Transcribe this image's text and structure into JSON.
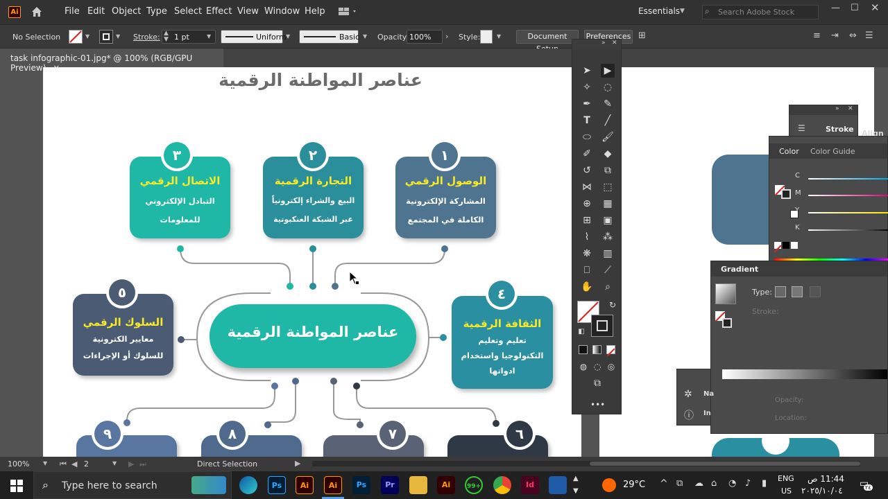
{
  "menubar": {
    "logo": "Ai",
    "items": [
      "File",
      "Edit",
      "Object",
      "Type",
      "Select",
      "Effect",
      "View",
      "Window",
      "Help"
    ],
    "workspace": "Essentials",
    "search_placeholder": "Search Adobe Stock"
  },
  "control": {
    "selection": "No Selection",
    "stroke_label": "Stroke:",
    "stroke_value": "1 pt",
    "profile": "Uniform",
    "brush": "Basic",
    "opacity_label": "Opacity:",
    "opacity_value": "100%",
    "style_label": "Style:",
    "doc_setup": "Document Setup",
    "preferences": "Preferences"
  },
  "tab": {
    "title": "task infographic-01.jpg* @ 100% (RGB/GPU Preview)",
    "close": "×"
  },
  "artboard": {
    "heading": "عناصر المواطنة الرقمية",
    "center_label": "عناصر المواطنة الرقمية",
    "cards": [
      {
        "num": "١",
        "title": "الوصول الرقمي",
        "lines": [
          "المشاركة الإلكترونية",
          "الكاملة في المجتمع"
        ],
        "color": "#4f7490"
      },
      {
        "num": "٢",
        "title": "التجارة الرقمية",
        "lines": [
          "البيع والشراء إلكترونياً",
          "عبر الشبكة العنكبوتية"
        ],
        "color": "#2a8f9a"
      },
      {
        "num": "٣",
        "title": "الاتصال الرقمي",
        "lines": [
          "التبادل الإلكتروني",
          "للمعلومات"
        ],
        "color": "#1fb8a6"
      },
      {
        "num": "٤",
        "title": "الثقافة الرقمية",
        "lines": [
          "تعليم وتعليم",
          "التكنولوجيا واستخدام",
          "ادواتها"
        ],
        "color": "#2a8fa0"
      },
      {
        "num": "٥",
        "title": "السلوك الرقمي",
        "lines": [
          "معايير الكترونية",
          "للسلوك أو الإجراءات"
        ],
        "color": "#4b5b74"
      },
      {
        "num": "٦",
        "color": "#2f3946"
      },
      {
        "num": "٧",
        "color": "#5a6275"
      },
      {
        "num": "٨",
        "color": "#4f6a8c"
      },
      {
        "num": "٩",
        "color": "#5876a0"
      }
    ]
  },
  "status": {
    "zoom": "100%",
    "page": "2",
    "tool": "Direct Selection"
  },
  "panels": {
    "stroke_title": "Stroke",
    "align_title": "Align",
    "color_tab": "Color",
    "color_guide_tab": "Color Guide",
    "channels": [
      "C",
      "M",
      "Y",
      "K"
    ],
    "gradient_title": "Gradient",
    "gradient_type": "Type:",
    "gradient_stroke": "Stroke:",
    "opacity": "Opacity:",
    "location": "Location:",
    "nav_abbrev": "Na",
    "info_abbrev": "In"
  },
  "taskbar": {
    "search_placeholder": "Type here to search",
    "temperature": "29°C",
    "lang": "ENG",
    "region": "US",
    "time": "11:44 ص",
    "date": "٢٠٢٥/١٠/٠٤",
    "notif_count": "٢٤",
    "badge": "99+"
  },
  "colors": {
    "accent": "#ff9a00",
    "teal": "#1fb8a6",
    "yellow": "#f6ea29"
  }
}
